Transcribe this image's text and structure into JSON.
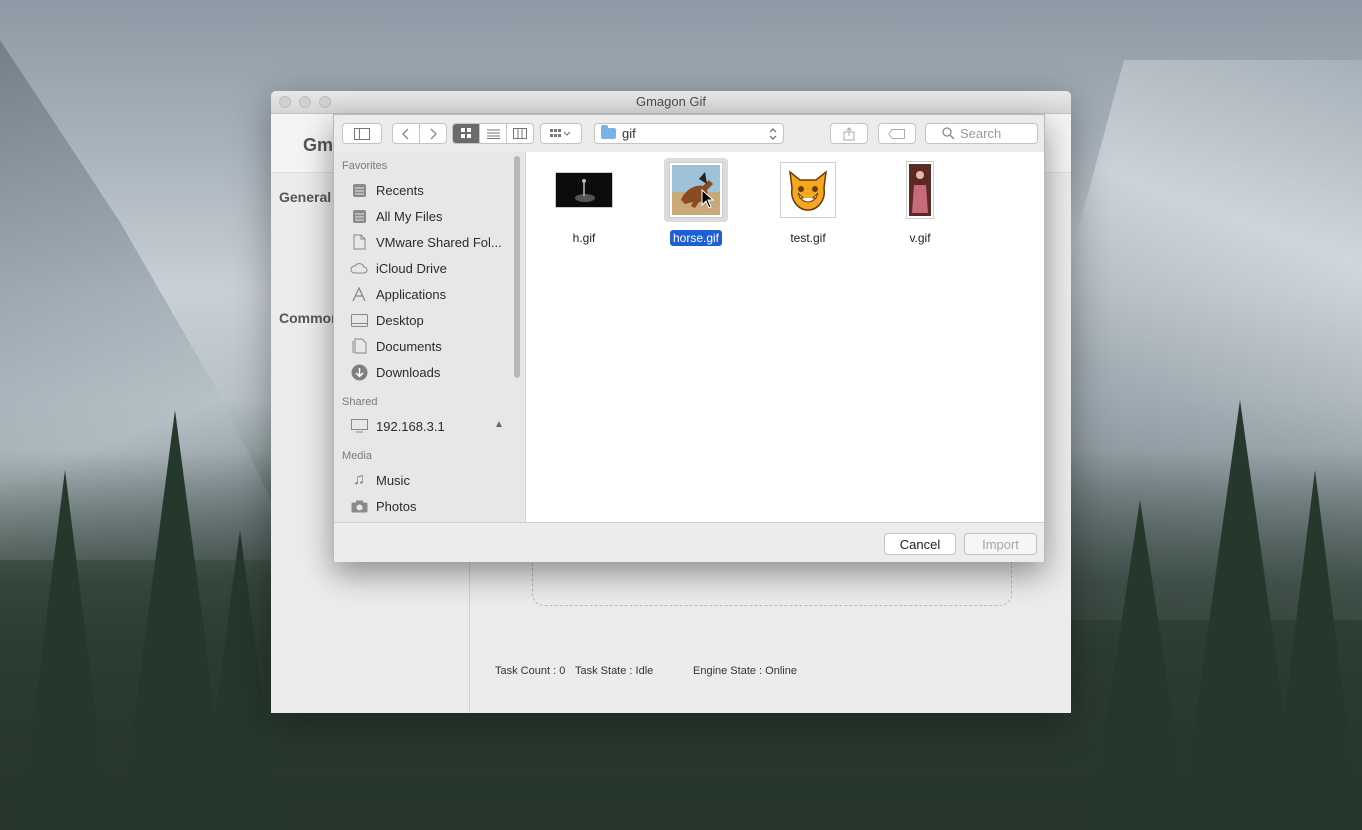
{
  "app": {
    "title": "Gmagon Gif",
    "brand_fragment": "Gm",
    "sidebar_sections": [
      "General",
      "Common"
    ],
    "status": {
      "task_count": "Task Count : 0",
      "task_state": "Task State : Idle",
      "engine_state": "Engine State : Online"
    }
  },
  "dialog": {
    "location": "gif",
    "search_placeholder": "Search",
    "sidebar": {
      "favorites_header": "Favorites",
      "favorites": [
        {
          "label": "Recents",
          "icon": "recents-icon"
        },
        {
          "label": "All My Files",
          "icon": "all-files-icon"
        },
        {
          "label": "VMware Shared Fol...",
          "icon": "document-icon"
        },
        {
          "label": "iCloud Drive",
          "icon": "cloud-icon"
        },
        {
          "label": "Applications",
          "icon": "applications-icon"
        },
        {
          "label": "Desktop",
          "icon": "desktop-icon"
        },
        {
          "label": "Documents",
          "icon": "documents-icon"
        },
        {
          "label": "Downloads",
          "icon": "downloads-icon"
        }
      ],
      "shared_header": "Shared",
      "shared": [
        {
          "label": "192.168.3.1",
          "icon": "computer-icon"
        }
      ],
      "media_header": "Media",
      "media": [
        {
          "label": "Music",
          "icon": "music-icon"
        },
        {
          "label": "Photos",
          "icon": "camera-icon"
        }
      ]
    },
    "files": [
      {
        "name": "h.gif",
        "selected": false
      },
      {
        "name": "horse.gif",
        "selected": true
      },
      {
        "name": "test.gif",
        "selected": false
      },
      {
        "name": "v.gif",
        "selected": false
      }
    ],
    "buttons": {
      "cancel": "Cancel",
      "import": "Import"
    }
  }
}
